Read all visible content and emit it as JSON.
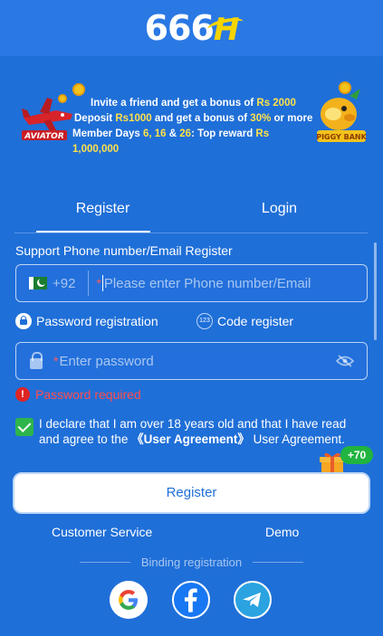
{
  "header": {
    "logo_text": "666",
    "logo_accent": "H"
  },
  "banner": {
    "line1_pre": "Invite a friend and get a bonus of ",
    "line1_amount": "Rs 2000",
    "line2_pre": "Deposit ",
    "line2_amount": "Rs1000",
    "line2_mid": " and get a bonus of ",
    "line2_pct": "30%",
    "line2_post": " or more",
    "line3_pre": "Member Days ",
    "line3_days": "6, 16",
    "line3_amp": " & ",
    "line3_day3": "26",
    "line3_mid": ": Top reward ",
    "line3_amount": "Rs 1,000,000",
    "left_game_label": "AVIATOR",
    "right_game_label": "PIGGY BANK"
  },
  "tabs": [
    {
      "label": "Register"
    },
    {
      "label": "Login"
    }
  ],
  "form": {
    "section_title": "Support Phone number/Email Register",
    "country_code": "+92",
    "phone_placeholder": "Please enter Phone number/Email",
    "option_password": "Password registration",
    "option_code": "Code register",
    "code_icon_text": "123",
    "password_placeholder": "Enter password",
    "error_text": "Password required",
    "agree_text": "I declare that I am over 18 years old and that I have read and agree to the ",
    "agree_link": "《User Agreement》",
    "agree_post": " User Agreement.",
    "bonus_badge": "+70",
    "register_button": "Register"
  },
  "links": {
    "customer_service": "Customer Service",
    "demo": "Demo"
  },
  "binding": {
    "label": "Binding registration"
  },
  "colors": {
    "background": "#1f6fd8",
    "error": "#ff4d4d",
    "checkbox": "#2db54b",
    "highlight": "#ffe14a"
  }
}
